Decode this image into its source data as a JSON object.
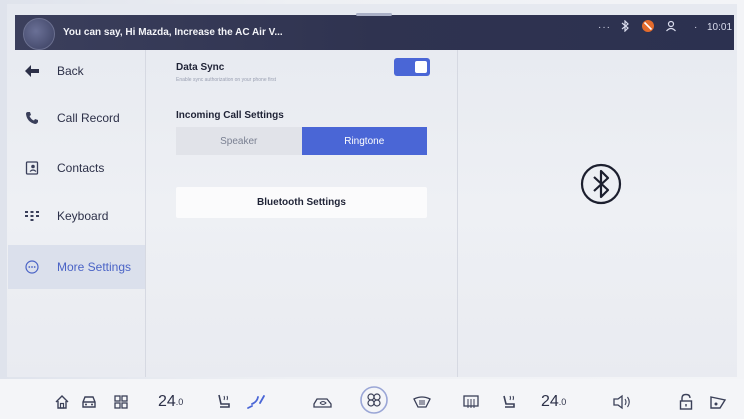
{
  "status_bar": {
    "voice_hint": "You can say, Hi Mazda, Increase the AC Air V...",
    "dots": "···",
    "signal": "·",
    "time": "10:01"
  },
  "sidebar": {
    "items": [
      {
        "label": "Back",
        "icon": "back-arrow-icon"
      },
      {
        "label": "Call Record",
        "icon": "phone-icon"
      },
      {
        "label": "Contacts",
        "icon": "contacts-icon"
      },
      {
        "label": "Keyboard",
        "icon": "keypad-icon"
      },
      {
        "label": "More Settings",
        "icon": "more-icon",
        "active": true
      }
    ]
  },
  "main": {
    "data_sync": {
      "title": "Data Sync",
      "subtitle": "Enable sync authorization on your phone first",
      "enabled": true
    },
    "incoming_call": {
      "title": "Incoming Call Settings",
      "options": [
        "Speaker",
        "Ringtone"
      ],
      "selected": "Ringtone"
    },
    "bluetooth_button": "Bluetooth Settings"
  },
  "dock": {
    "temp_left": "24",
    "temp_left_decimal": ".0",
    "temp_right": "24",
    "temp_right_decimal": ".0",
    "items": [
      "home-icon",
      "car-icon",
      "apps-icon",
      "seat-heat-left-icon",
      "airflow-icon",
      "recirculation-icon",
      "fan-icon",
      "front-defrost-icon",
      "rear-defrost-icon",
      "seat-heat-right-icon",
      "volume-icon",
      "lock-icon",
      "car-settings-icon"
    ]
  },
  "colors": {
    "accent": "#4a66d6",
    "status_bar": "#2f3350",
    "background": "#eef0f4"
  }
}
